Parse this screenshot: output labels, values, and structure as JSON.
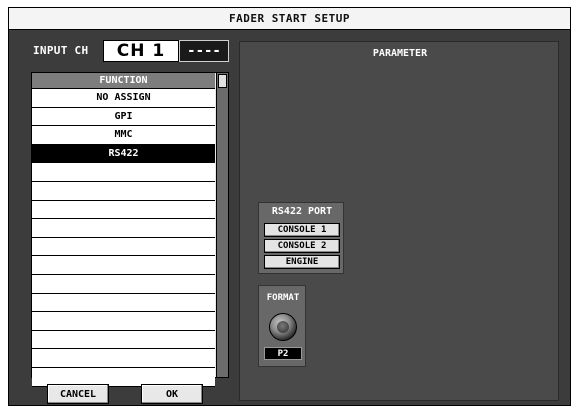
{
  "window": {
    "title": "FADER START SETUP"
  },
  "input": {
    "label": "INPUT CH",
    "channel": "CH 1",
    "name": "----"
  },
  "function_list": {
    "header": "FUNCTION",
    "items": [
      "NO ASSIGN",
      "GPI",
      "MMC",
      "RS422",
      "",
      "",
      "",
      "",
      "",
      "",
      "",
      "",
      "",
      "",
      "",
      ""
    ],
    "selected_index": 3
  },
  "buttons": {
    "cancel": "CANCEL",
    "ok": "OK"
  },
  "parameter": {
    "title": "PARAMETER",
    "rs422_port": {
      "title": "RS422 PORT",
      "options": [
        "CONSOLE 1",
        "CONSOLE 2",
        "ENGINE"
      ]
    },
    "format": {
      "title": "FORMAT",
      "value": "P2",
      "knob_icon": "rotary-knob-icon"
    }
  }
}
